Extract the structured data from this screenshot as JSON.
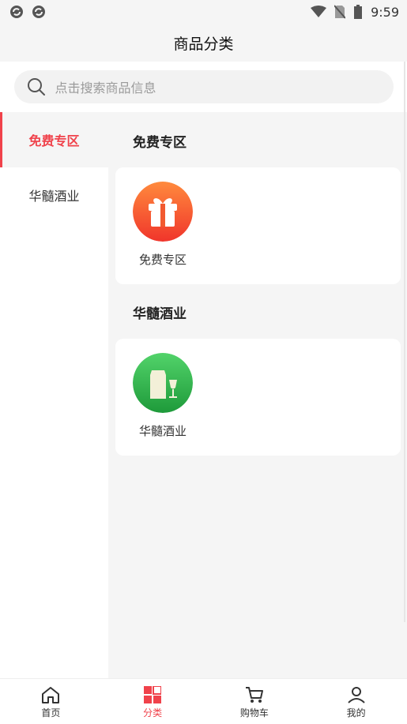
{
  "status_bar": {
    "time": "9:59"
  },
  "header": {
    "title": "商品分类"
  },
  "search": {
    "placeholder": "点击搜索商品信息"
  },
  "sidebar": {
    "items": [
      {
        "label": "免费专区",
        "active": true
      },
      {
        "label": "华髓酒业",
        "active": false
      }
    ]
  },
  "sections": [
    {
      "title": "免费专区",
      "items": [
        {
          "label": "免费专区",
          "icon": "gift-icon"
        }
      ]
    },
    {
      "title": "华髓酒业",
      "items": [
        {
          "label": "华髓酒业",
          "icon": "wine-icon"
        }
      ]
    }
  ],
  "tabbar": {
    "items": [
      {
        "label": "首页",
        "icon": "home-icon",
        "active": false
      },
      {
        "label": "分类",
        "icon": "category-icon",
        "active": true
      },
      {
        "label": "购物车",
        "icon": "cart-icon",
        "active": false
      },
      {
        "label": "我的",
        "icon": "user-icon",
        "active": false
      }
    ]
  },
  "colors": {
    "accent": "#f0424b",
    "gift_gradient": [
      "#ff8a3d",
      "#f0352b"
    ],
    "wine_gradient": [
      "#52d36a",
      "#1e9a3a"
    ]
  }
}
